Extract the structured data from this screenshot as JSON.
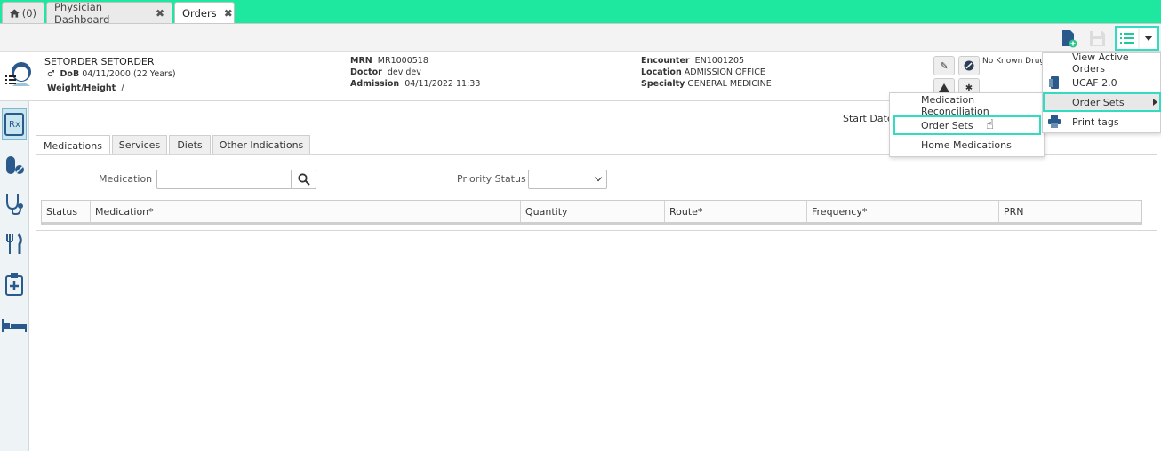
{
  "tabs": [
    {
      "label": "(0)",
      "icon": "home-icon"
    },
    {
      "label": "Physician Dashboard"
    },
    {
      "label": "Orders"
    }
  ],
  "patient": {
    "name": "SETORDER SETORDER",
    "dob_label": "DoB",
    "dob_value": "04/11/2000 (22 Years)",
    "weight_label": "Weight/Height",
    "weight_value": "/",
    "mrn_label": "MRN",
    "mrn_value": "MR1000518",
    "doctor_label": "Doctor",
    "doctor_value": "dev dev",
    "admission_label": "Admission",
    "admission_value": "04/11/2022 11:33",
    "encounter_label": "Encounter",
    "encounter_value": "EN1001205",
    "location_label": "Location",
    "location_value": "ADMISSION OFFICE",
    "specialty_label": "Specialty",
    "specialty_value": "GENERAL MEDICINE",
    "allergy_text": "No Known Drug"
  },
  "content": {
    "start_date_label": "Start Date",
    "subtabs": [
      "Medications",
      "Services",
      "Diets",
      "Other Indications"
    ],
    "medication_label": "Medication",
    "medication_value": "",
    "priority_label": "Priority Status",
    "priority_value": "",
    "columns": [
      "Status",
      "Medication*",
      "Quantity",
      "Route*",
      "Frequency*",
      "PRN",
      "",
      ""
    ]
  },
  "main_menu": [
    {
      "label": "View Active Orders",
      "icon": ""
    },
    {
      "label": "UCAF 2.0",
      "icon": "document-icon"
    },
    {
      "label": "Order Sets",
      "icon": "",
      "submenu": true
    },
    {
      "label": "Print tags",
      "icon": "printer-icon"
    }
  ],
  "sub_menu": [
    {
      "label": "Medication Reconciliation"
    },
    {
      "label": "Order Sets"
    },
    {
      "label": "Home Medications"
    }
  ],
  "colors": {
    "tabbar": "#1ee89f",
    "highlight": "#33dbc0",
    "icon_blue": "#2a5a8c"
  }
}
